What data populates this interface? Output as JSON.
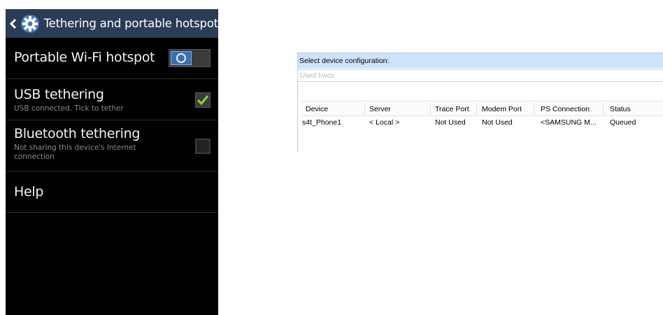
{
  "phone": {
    "header_title": "Tethering and portable hotspot",
    "settings": [
      {
        "title": "Portable Wi-Fi hotspot",
        "subtitle": "",
        "control": "toggle",
        "state": "on"
      },
      {
        "title": "USB tethering",
        "subtitle": "USB connected. Tick to tether",
        "control": "checkbox",
        "state": "checked"
      },
      {
        "title": "Bluetooth tethering",
        "subtitle": "Not sharing this device's Internet connection",
        "control": "checkbox",
        "state": "unchecked"
      },
      {
        "title": "Help",
        "subtitle": "",
        "control": "none",
        "state": ""
      }
    ],
    "colors": {
      "header_bg": "#2b3c55",
      "toggle_on": "#3a6fb0",
      "check": "#8ed23a"
    }
  },
  "dialog": {
    "select_label": "Select device configuration:",
    "combo_value": "Used hwcx",
    "table": {
      "columns": [
        "Device",
        "Server",
        "Trace Port",
        "Modem Port",
        "PS Connection",
        "Status"
      ],
      "rows": [
        [
          "s4t_Phone1",
          "< Local >",
          "Not Used",
          "Not Used",
          "<SAMSUNG M...",
          "Queued"
        ]
      ]
    },
    "colors": {
      "strip_bg": "#cfe3fb"
    }
  }
}
